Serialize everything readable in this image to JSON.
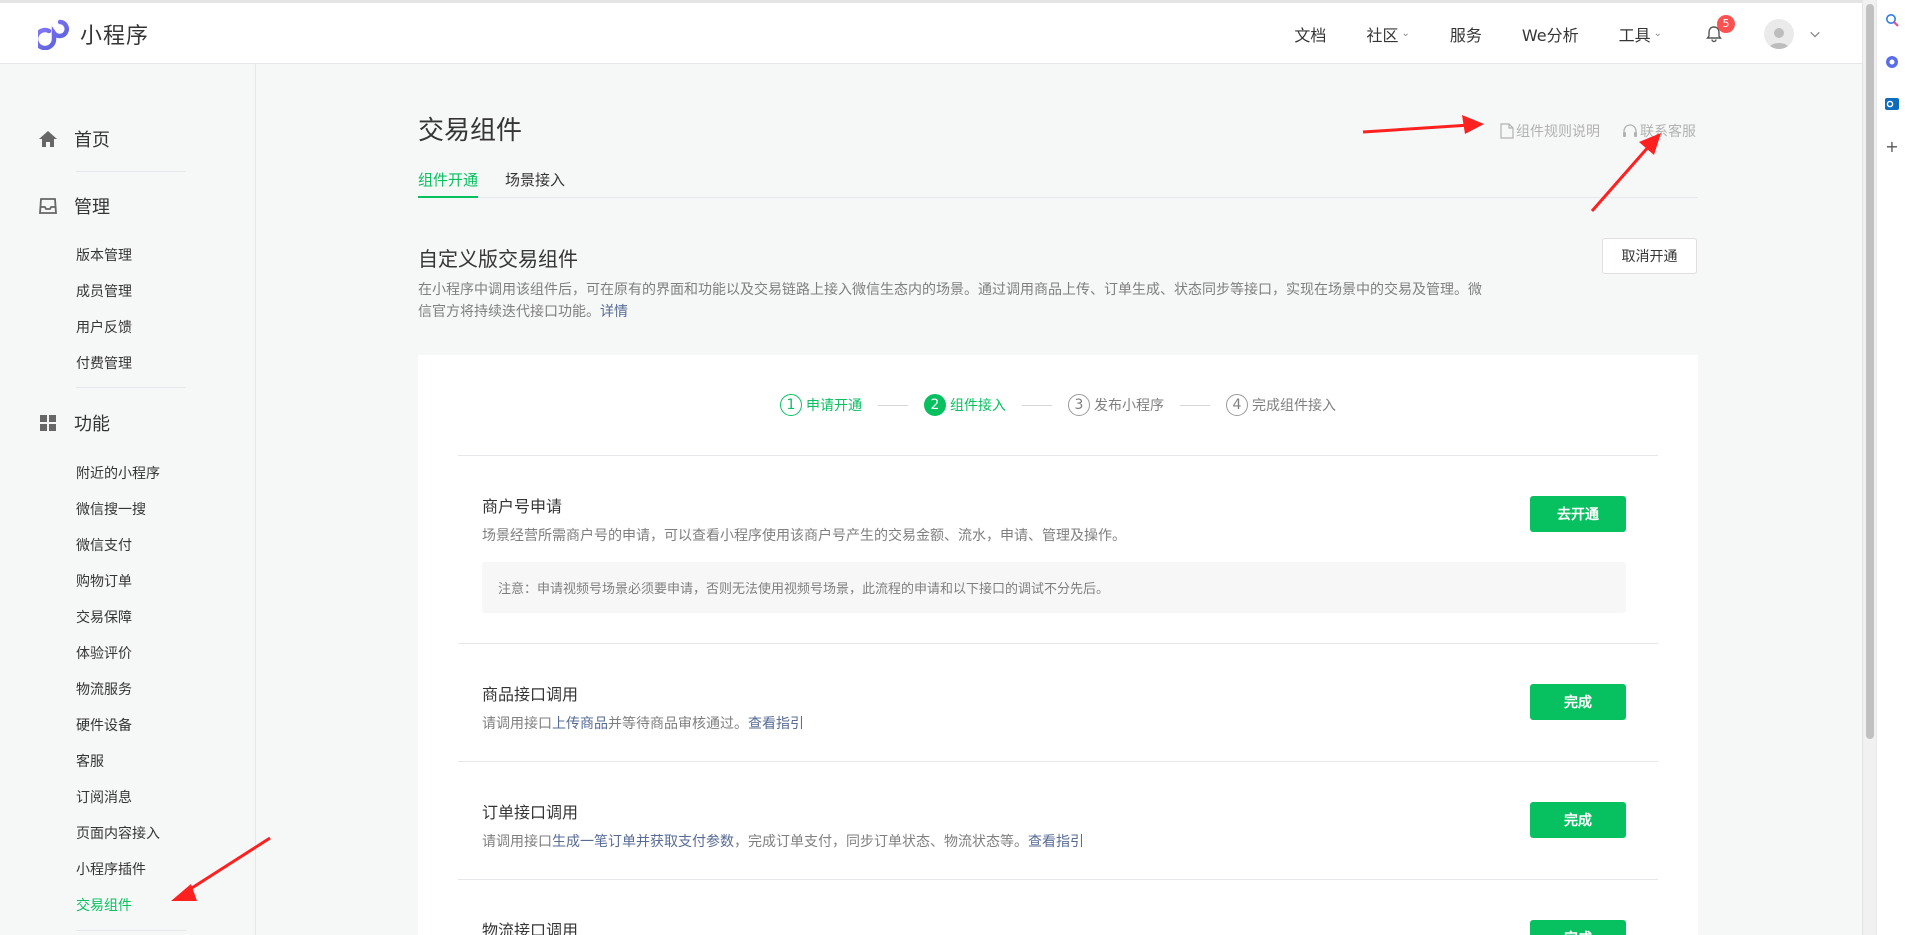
{
  "app": {
    "logo_text": "小程序"
  },
  "header": {
    "nav": [
      {
        "label": "文档",
        "dropdown": false
      },
      {
        "label": "社区",
        "dropdown": true
      },
      {
        "label": "服务",
        "dropdown": false
      },
      {
        "label": "We分析",
        "dropdown": false
      },
      {
        "label": "工具",
        "dropdown": true
      }
    ],
    "notification_count": "5",
    "icons": [
      "bell-icon",
      "avatar-icon",
      "chevron-down-icon"
    ]
  },
  "sidebar": {
    "home": "首页",
    "manage": {
      "title": "管理",
      "items": [
        "版本管理",
        "成员管理",
        "用户反馈",
        "付费管理"
      ]
    },
    "features": {
      "title": "功能",
      "items": [
        "附近的小程序",
        "微信搜一搜",
        "微信支付",
        "购物订单",
        "交易保障",
        "体验评价",
        "物流服务",
        "硬件设备",
        "客服",
        "订阅消息",
        "页面内容接入",
        "小程序插件",
        "交易组件"
      ],
      "active": "交易组件"
    }
  },
  "main": {
    "title": "交易组件",
    "rule_link": "组件规则说明",
    "service_link": "联系客服",
    "tabs": [
      {
        "label": "组件开通",
        "active": true
      },
      {
        "label": "场景接入",
        "active": false
      }
    ],
    "section": {
      "title": "自定义版交易组件",
      "desc_line1": "在小程序中调用该组件后，可在原有的界面和功能以及交易链路上接入微信生态内的场景。通过调用商品上传、订单生成、状态同步等接口，实现在场景中的交易及管理。微",
      "desc_line2": "信官方将持续迭代接口功能。",
      "detail_link": "详情",
      "cancel_button": "取消开通"
    },
    "steps": [
      {
        "num": "1",
        "label": "申请开通",
        "state": "done"
      },
      {
        "num": "2",
        "label": "组件接入",
        "state": "current"
      },
      {
        "num": "3",
        "label": "发布小程序",
        "state": "todo"
      },
      {
        "num": "4",
        "label": "完成组件接入",
        "state": "todo"
      }
    ],
    "items": [
      {
        "title": "商户号申请",
        "desc": "场景经营所需商户号的申请，可以查看小程序使用该商户号产生的交易金额、流水，申请、管理及操作。",
        "notice": "注意：申请视频号场景必须要申请，否则无法使用视频号场景，此流程的申请和以下接口的调试不分先后。",
        "button": "去开通"
      },
      {
        "title": "商品接口调用",
        "desc_pre": "请调用接口",
        "desc_link1": "上传商品",
        "desc_mid": "并等待商品审核通过。",
        "desc_link2": "查看指引",
        "button": "完成"
      },
      {
        "title": "订单接口调用",
        "desc_pre": "请调用接口",
        "desc_link1": "生成一笔订单并获取支付参数",
        "desc_mid": "，完成订单支付，同步订单状态、物流状态等。",
        "desc_link2": "查看指引",
        "button": "完成"
      },
      {
        "title": "物流接口调用",
        "button": "完成"
      }
    ]
  },
  "colors": {
    "accent": "#07c160",
    "link": "#576b95",
    "badge": "#fa5151",
    "annotation_arrow": "#ff2020"
  }
}
